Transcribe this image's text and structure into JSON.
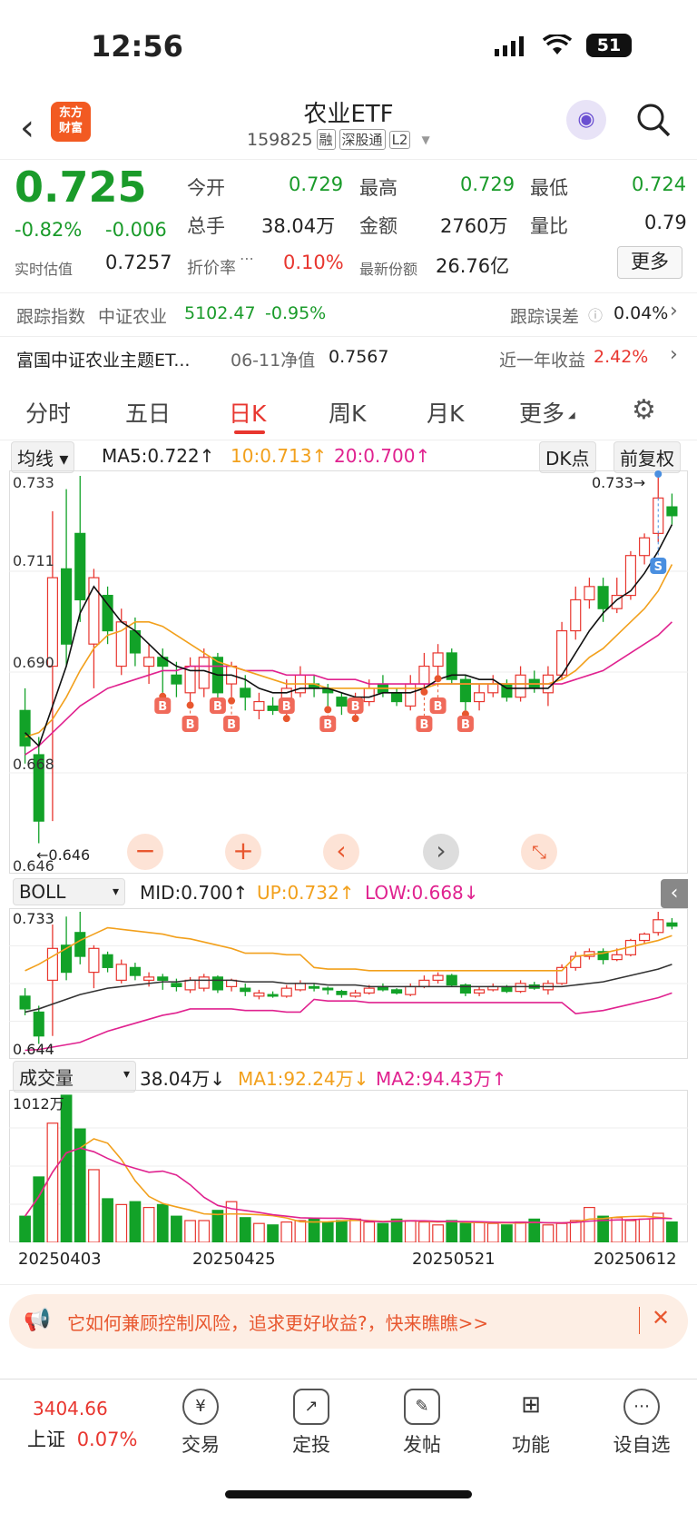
{
  "status": {
    "time": "12:56",
    "battery": "51"
  },
  "header": {
    "title": "农业ETF",
    "code": "159825",
    "tags": [
      "融",
      "深股通",
      "L2"
    ],
    "logo_line1": "东方",
    "logo_line2": "财富"
  },
  "quote": {
    "price": "0.725",
    "change_pct": "-0.82%",
    "change": "-0.006",
    "open_label": "今开",
    "open": "0.729",
    "high_label": "最高",
    "high": "0.729",
    "low_label": "最低",
    "low": "0.724",
    "volume_label": "总手",
    "volume": "38.04万",
    "amount_label": "金额",
    "amount": "2760万",
    "ratio_label": "量比",
    "ratio": "0.79",
    "est_label": "实时估值",
    "est": "0.7257",
    "discount_label": "折价率",
    "discount": "0.10%",
    "shares_label": "最新份额",
    "shares": "26.76亿",
    "more_button": "更多"
  },
  "tracking": {
    "index_label": "跟踪指数",
    "index_name": "中证农业",
    "index_value": "5102.47",
    "index_change": "-0.95%",
    "error_label": "跟踪误差",
    "error": "0.04%"
  },
  "fund": {
    "name": "富国中证农业主题ET...",
    "nav_label": "06-11净值",
    "nav": "0.7567",
    "return_label": "近一年收益",
    "return": "2.42%"
  },
  "tabs": [
    "分时",
    "五日",
    "日K",
    "周K",
    "月K",
    "更多"
  ],
  "chart_controls": {
    "ma_select": "均线",
    "ma5": "MA5:0.722↑",
    "ma10": "10:0.713↑",
    "ma20": "20:0.700↑",
    "dk_button": "DK点",
    "adjust_button": "前复权",
    "boll_select": "BOLL",
    "boll_mid": "MID:0.700↑",
    "boll_up": "UP:0.732↑",
    "boll_low": "LOW:0.668↓",
    "vol_select": "成交量",
    "vol": "38.04万↓",
    "vol_ma1": "MA1:92.24万↓",
    "vol_ma2": "MA2:94.43万↑"
  },
  "chart_data": {
    "type": "candlestick",
    "price_axis": {
      "top": "0.733",
      "ticks": [
        "0.711",
        "0.690",
        "0.668"
      ],
      "bottom": "0.646"
    },
    "annotations": {
      "high_marker": "0.733→",
      "low_marker": "←0.646",
      "sell_label": "S",
      "buy_label": "B"
    },
    "boll_axis": {
      "top": "0.733",
      "bottom": "0.644"
    },
    "volume_axis": {
      "top": "1012万"
    },
    "dates": [
      "20250403",
      "20250425",
      "20250521",
      "20250612"
    ],
    "candles": [
      [
        0.68,
        0.672,
        0.685,
        0.668
      ],
      [
        0.67,
        0.655,
        0.674,
        0.65
      ],
      [
        0.69,
        0.71,
        0.725,
        0.655
      ],
      [
        0.712,
        0.695,
        0.73,
        0.69
      ],
      [
        0.72,
        0.705,
        0.733,
        0.7
      ],
      [
        0.695,
        0.71,
        0.712,
        0.685
      ],
      [
        0.706,
        0.698,
        0.708,
        0.695
      ],
      [
        0.69,
        0.7,
        0.703,
        0.688
      ],
      [
        0.698,
        0.693,
        0.701,
        0.69
      ],
      [
        0.69,
        0.692,
        0.695,
        0.686
      ],
      [
        0.692,
        0.69,
        0.694,
        0.684
      ],
      [
        0.688,
        0.686,
        0.691,
        0.683
      ],
      [
        0.684,
        0.69,
        0.692,
        0.682
      ],
      [
        0.685,
        0.692,
        0.694,
        0.683
      ],
      [
        0.692,
        0.684,
        0.693,
        0.682
      ],
      [
        0.686,
        0.69,
        0.691,
        0.683
      ],
      [
        0.685,
        0.683,
        0.688,
        0.68
      ],
      [
        0.68,
        0.682,
        0.684,
        0.678
      ],
      [
        0.681,
        0.68,
        0.683,
        0.679
      ],
      [
        0.68,
        0.685,
        0.687,
        0.679
      ],
      [
        0.684,
        0.688,
        0.69,
        0.683
      ],
      [
        0.686,
        0.685,
        0.688,
        0.683
      ],
      [
        0.685,
        0.684,
        0.686,
        0.681
      ],
      [
        0.683,
        0.681,
        0.684,
        0.679
      ],
      [
        0.68,
        0.682,
        0.684,
        0.679
      ],
      [
        0.682,
        0.685,
        0.687,
        0.681
      ],
      [
        0.686,
        0.684,
        0.688,
        0.683
      ],
      [
        0.684,
        0.682,
        0.685,
        0.681
      ],
      [
        0.681,
        0.686,
        0.688,
        0.68
      ],
      [
        0.686,
        0.69,
        0.693,
        0.685
      ],
      [
        0.69,
        0.693,
        0.695,
        0.688
      ],
      [
        0.693,
        0.687,
        0.694,
        0.686
      ],
      [
        0.687,
        0.682,
        0.688,
        0.68
      ],
      [
        0.682,
        0.684,
        0.686,
        0.68
      ],
      [
        0.684,
        0.686,
        0.688,
        0.683
      ],
      [
        0.686,
        0.683,
        0.687,
        0.682
      ],
      [
        0.683,
        0.688,
        0.69,
        0.682
      ],
      [
        0.687,
        0.685,
        0.689,
        0.684
      ],
      [
        0.684,
        0.688,
        0.69,
        0.681
      ],
      [
        0.688,
        0.698,
        0.7,
        0.687
      ],
      [
        0.698,
        0.705,
        0.708,
        0.696
      ],
      [
        0.705,
        0.708,
        0.71,
        0.703
      ],
      [
        0.708,
        0.703,
        0.71,
        0.7
      ],
      [
        0.703,
        0.706,
        0.71,
        0.702
      ],
      [
        0.706,
        0.715,
        0.716,
        0.705
      ],
      [
        0.715,
        0.719,
        0.72,
        0.713
      ],
      [
        0.72,
        0.728,
        0.733,
        0.718
      ],
      [
        0.726,
        0.724,
        0.729,
        0.722
      ]
    ],
    "ma5": [
      0.675,
      0.672,
      0.681,
      0.69,
      0.702,
      0.708,
      0.704,
      0.7,
      0.698,
      0.695,
      0.692,
      0.69,
      0.689,
      0.689,
      0.688,
      0.688,
      0.687,
      0.685,
      0.684,
      0.684,
      0.685,
      0.685,
      0.685,
      0.684,
      0.683,
      0.683,
      0.684,
      0.684,
      0.684,
      0.685,
      0.687,
      0.688,
      0.688,
      0.687,
      0.687,
      0.685,
      0.685,
      0.685,
      0.685,
      0.688,
      0.693,
      0.698,
      0.702,
      0.705,
      0.707,
      0.711,
      0.716,
      0.722
    ],
    "ma10": [
      0.674,
      0.675,
      0.678,
      0.683,
      0.689,
      0.694,
      0.697,
      0.698,
      0.7,
      0.7,
      0.699,
      0.697,
      0.695,
      0.693,
      0.691,
      0.69,
      0.689,
      0.688,
      0.687,
      0.686,
      0.686,
      0.686,
      0.685,
      0.685,
      0.685,
      0.685,
      0.685,
      0.685,
      0.685,
      0.685,
      0.686,
      0.686,
      0.686,
      0.686,
      0.686,
      0.686,
      0.686,
      0.686,
      0.686,
      0.687,
      0.689,
      0.692,
      0.694,
      0.697,
      0.7,
      0.703,
      0.707,
      0.713
    ],
    "ma20": [
      0.67,
      0.672,
      0.675,
      0.678,
      0.681,
      0.683,
      0.685,
      0.686,
      0.687,
      0.688,
      0.689,
      0.689,
      0.69,
      0.69,
      0.69,
      0.69,
      0.689,
      0.689,
      0.689,
      0.688,
      0.688,
      0.688,
      0.687,
      0.687,
      0.687,
      0.686,
      0.686,
      0.686,
      0.686,
      0.686,
      0.686,
      0.686,
      0.686,
      0.686,
      0.686,
      0.686,
      0.686,
      0.686,
      0.686,
      0.686,
      0.687,
      0.688,
      0.689,
      0.691,
      0.693,
      0.695,
      0.697,
      0.7
    ],
    "volumes": [
      180,
      450,
      820,
      1012,
      780,
      500,
      300,
      260,
      280,
      240,
      260,
      180,
      150,
      150,
      220,
      280,
      170,
      130,
      120,
      140,
      150,
      160,
      140,
      150,
      160,
      140,
      130,
      160,
      150,
      140,
      120,
      150,
      130,
      140,
      130,
      120,
      140,
      160,
      120,
      130,
      150,
      240,
      180,
      170,
      150,
      160,
      200,
      140
    ]
  },
  "banner": {
    "text": "它如何兼顾控制风险，追求更好收益?，快来瞧瞧>>"
  },
  "bottom_nav": {
    "index_value": "3404.66",
    "index_name": "上证",
    "index_change": "0.07%",
    "items": [
      "交易",
      "定投",
      "发帖",
      "功能",
      "设自选"
    ]
  }
}
